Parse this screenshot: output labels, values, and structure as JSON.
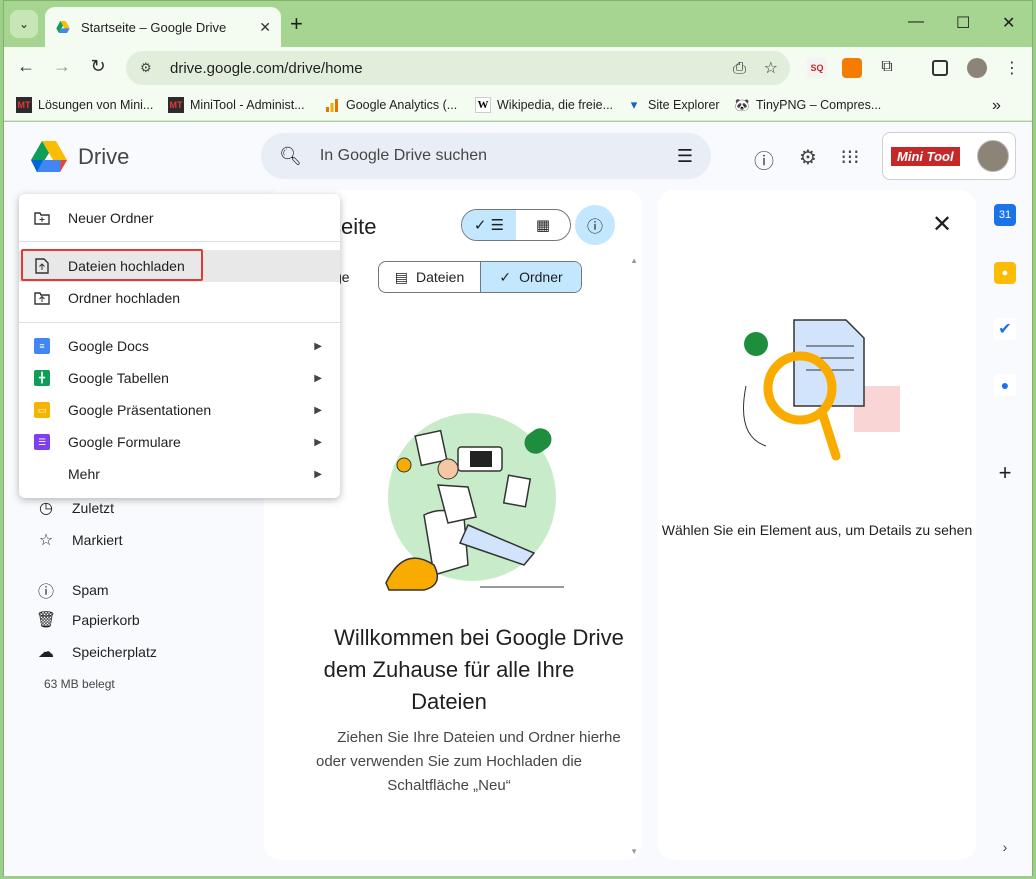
{
  "browser": {
    "tab_title": "Startseite – Google Drive",
    "url": "drive.google.com/drive/home",
    "bookmarks": [
      {
        "label": "Lösungen von Mini...",
        "icon": "minitool-icon"
      },
      {
        "label": "MiniTool - Administ...",
        "icon": "minitool-icon"
      },
      {
        "label": "Google Analytics  (...",
        "icon": "analytics-icon"
      },
      {
        "label": "Wikipedia, die freie...",
        "icon": "wikipedia-icon"
      },
      {
        "label": "Site Explorer",
        "icon": "site-explorer-icon"
      },
      {
        "label": "TinyPNG – Compres...",
        "icon": "tinypng-icon"
      }
    ]
  },
  "header": {
    "app_name": "Drive",
    "search_placeholder": "In Google Drive suchen",
    "account_logo": "Mini Tool"
  },
  "menu": {
    "items": [
      {
        "label": "Neuer Ordner",
        "icon": "new-folder-icon"
      },
      {
        "label": "Dateien hochladen",
        "icon": "file-upload-icon"
      },
      {
        "label": "Ordner hochladen",
        "icon": "folder-upload-icon"
      },
      {
        "label": "Google Docs",
        "icon": "docs-icon",
        "color": "#4285f4"
      },
      {
        "label": "Google Tabellen",
        "icon": "sheets-icon",
        "color": "#0f9d58"
      },
      {
        "label": "Google Präsentationen",
        "icon": "slides-icon",
        "color": "#f4b400"
      },
      {
        "label": "Google Formulare",
        "icon": "forms-icon",
        "color": "#7e3ff2"
      },
      {
        "label": "Mehr",
        "icon": ""
      }
    ]
  },
  "nav": {
    "recent": "Zuletzt",
    "starred": "Markiert",
    "spam": "Spam",
    "trash": "Papierkorb",
    "storage": "Speicherplatz",
    "storage_used": "63 MB belegt"
  },
  "main": {
    "heading": "seite",
    "chips_lead": "ge",
    "chip_files": "Dateien",
    "chip_folders": "Ordner",
    "welcome_line1": "Willkommen bei Google Drive",
    "welcome_line2": "dem Zuhause für alle Ihre",
    "welcome_line3": "Dateien",
    "sub_line1": "Ziehen Sie Ihre Dateien und Ordner hierhe",
    "sub_line2": "oder verwenden Sie zum Hochladen die",
    "sub_line3": "Schaltfläche „Neu“"
  },
  "details": {
    "message": "Wählen Sie ein Element aus, um Details zu sehen"
  },
  "colors": {
    "browser_frame": "#a6d591",
    "highlight_box": "#e53935",
    "selected_chip": "#c2e7ff"
  }
}
